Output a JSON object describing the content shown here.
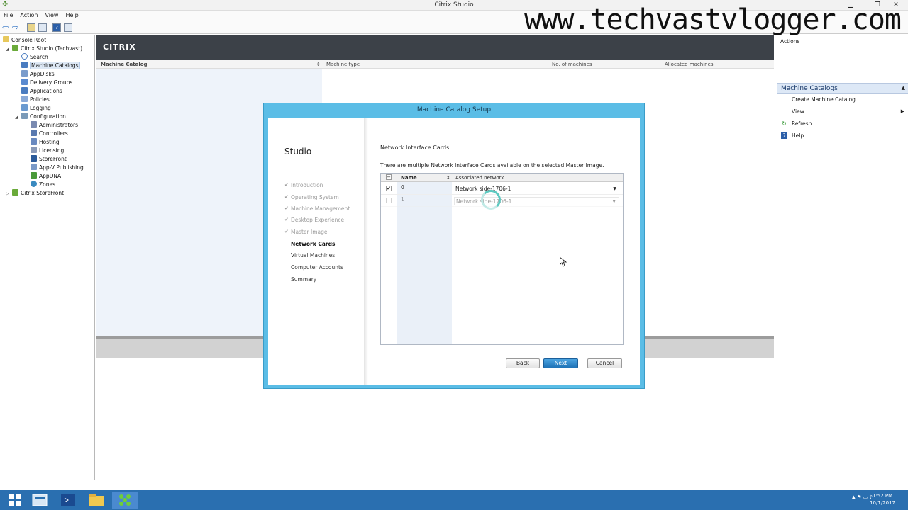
{
  "window": {
    "title": "Citrix Studio"
  },
  "watermark": "www.techvastvlogger.com",
  "menu": [
    "File",
    "Action",
    "View",
    "Help"
  ],
  "tree": {
    "root": "Console Root",
    "studio": "Citrix Studio (Techvast)",
    "items": [
      "Search",
      "Machine Catalogs",
      "AppDisks",
      "Delivery Groups",
      "Applications",
      "Policies",
      "Logging"
    ],
    "configuration": "Configuration",
    "config_items": [
      "Administrators",
      "Controllers",
      "Hosting",
      "Licensing",
      "StoreFront",
      "App-V Publishing",
      "AppDNA",
      "Zones"
    ],
    "storefront": "Citrix StoreFront"
  },
  "header": {
    "logo": "CITRIX"
  },
  "columns": [
    "Machine Catalog",
    "Machine type",
    "No. of machines",
    "Allocated machines"
  ],
  "actions": {
    "header": "Actions",
    "section": "Machine Catalogs",
    "items": [
      "Create Machine Catalog",
      "View",
      "Refresh",
      "Help"
    ]
  },
  "dialog": {
    "title": "Machine Catalog Setup",
    "studio_label": "Studio",
    "steps": [
      {
        "label": "Introduction",
        "state": "done"
      },
      {
        "label": "Operating System",
        "state": "done"
      },
      {
        "label": "Machine Management",
        "state": "done"
      },
      {
        "label": "Desktop Experience",
        "state": "done"
      },
      {
        "label": "Master Image",
        "state": "done"
      },
      {
        "label": "Network Cards",
        "state": "current"
      },
      {
        "label": "Virtual Machines",
        "state": "future"
      },
      {
        "label": "Computer Accounts",
        "state": "future"
      },
      {
        "label": "Summary",
        "state": "future"
      }
    ],
    "section_title": "Network Interface Cards",
    "description": "There are multiple Network Interface Cards available on the selected Master Image.",
    "grid": {
      "headers": [
        "Name",
        "Associated network"
      ],
      "rows": [
        {
          "name": "0",
          "network": "Network side-1706-1",
          "checked": true
        },
        {
          "name": "1",
          "network": "Network side-1706-1",
          "checked": false
        }
      ]
    },
    "buttons": {
      "back": "Back",
      "next": "Next",
      "cancel": "Cancel"
    }
  },
  "taskbar": {
    "time": "1:52 PM",
    "date": "10/1/2017"
  }
}
